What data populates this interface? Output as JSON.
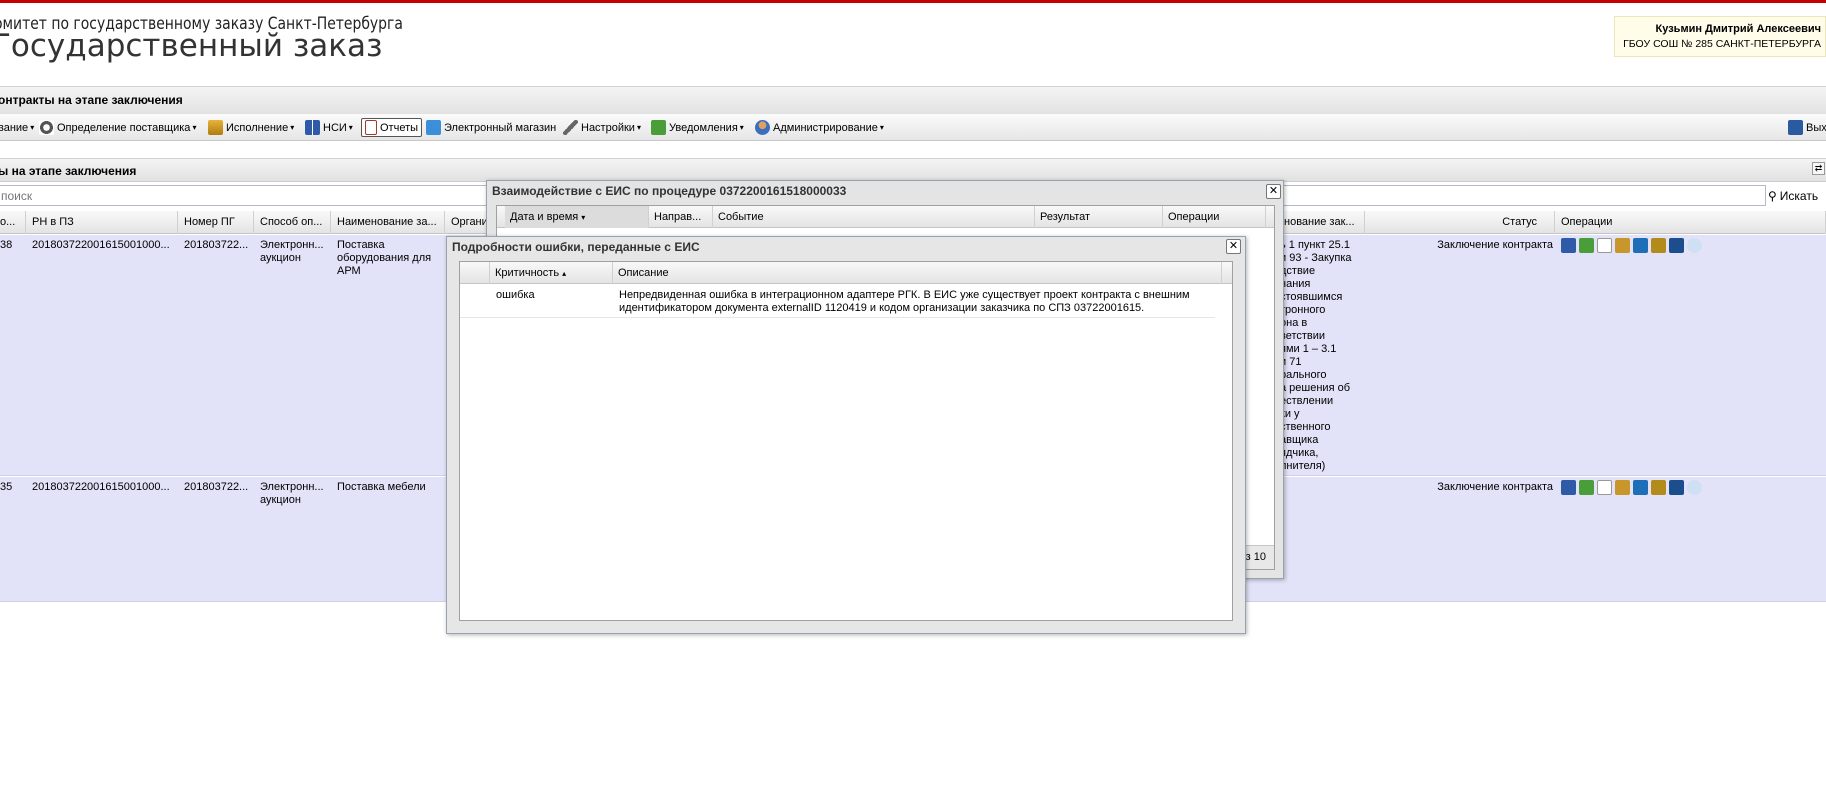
{
  "header": {
    "org_name": "омитет по государственному заказу Санкт-Петербурга",
    "app_title": "Государственный заказ",
    "user_name": "Кузьмин Дмитрий Алексеевич",
    "user_org": "ГБОУ СОШ № 285 САНКТ-ПЕТЕРБУРГА"
  },
  "breadcrumb": {
    "title": "онтракты на этапе заключения"
  },
  "toolbar": {
    "items": [
      {
        "label": "вание",
        "has_menu": true
      },
      {
        "label": "Определение поставщика",
        "has_menu": true,
        "icon": "gears-icon"
      },
      {
        "label": "Исполнение",
        "has_menu": true,
        "icon": "folder-icon"
      },
      {
        "label": "НСИ",
        "has_menu": true,
        "icon": "book-icon"
      },
      {
        "label": "Отчеты",
        "has_menu": false,
        "icon": "report-icon",
        "selected": true
      },
      {
        "label": "Электронный магазин",
        "has_menu": false,
        "icon": "cart-icon"
      },
      {
        "label": "Настройки",
        "has_menu": true,
        "icon": "wrench-icon"
      },
      {
        "label": "Уведомления",
        "has_menu": true,
        "icon": "envelope-icon"
      },
      {
        "label": "Администрирование",
        "has_menu": true,
        "icon": "user-icon"
      }
    ],
    "exit_label": "Вых"
  },
  "panel": {
    "title": "ы на этапе заключения",
    "search_placeholder": "поиск",
    "search_button": "Искать"
  },
  "grid": {
    "columns": [
      "о...",
      "РН в ПЗ",
      "Номер ПГ",
      "Способ оп...",
      "Наименование за...",
      "Органи",
      "нование зак...",
      "Статус",
      "Операции"
    ],
    "rows": [
      {
        "id": "38",
        "rn": "20180372200161500100​0...",
        "pg": "201803722...",
        "method": "Электронн...\nаукцион",
        "name": "Поставка\nоборудования для\nАРМ",
        "basis": "ь 1 пункт 25.1\nи 93 - Закупка\nдствие\nнания\nстоявшимся\nтронного\nона в\nветствии\nями 1 – 3.1\nи 71\nрального\nа решения об\nествлении\nки у\nственного\nавщика\nядчика,\nлнителя)",
        "status": "Заключение контракта"
      },
      {
        "id": "35",
        "rn": "20180372200161500100​0...",
        "pg": "201803722...",
        "method": "Электронн...\nаукцион",
        "name": "Поставка мебели",
        "basis": "",
        "status": "Заключение контракта"
      }
    ]
  },
  "dialog_eis": {
    "title": "Взаимодействие с ЕИС по процедуре 0372200161518000033",
    "columns": [
      "Дата и время",
      "Направ...",
      "Событие",
      "Результат",
      "Операции"
    ],
    "pager_text": "з 10"
  },
  "dialog_error": {
    "title": "Подробности ошибки, переданные с ЕИС",
    "columns": [
      "Критичность",
      "Описание"
    ],
    "rows": [
      {
        "severity": "ошибка",
        "description": "Непредвиденная ошибка в интеграционном адаптере РГК. В ЕИС уже существует проект контракта с внешним идентификатором документа externalID 1120419 и кодом организации заказчика по СПЗ 03722001615."
      }
    ]
  },
  "colors": {
    "accent_red": "#c40000",
    "row_highlight": "#e2e2f8",
    "user_box_bg": "#fffde9"
  }
}
